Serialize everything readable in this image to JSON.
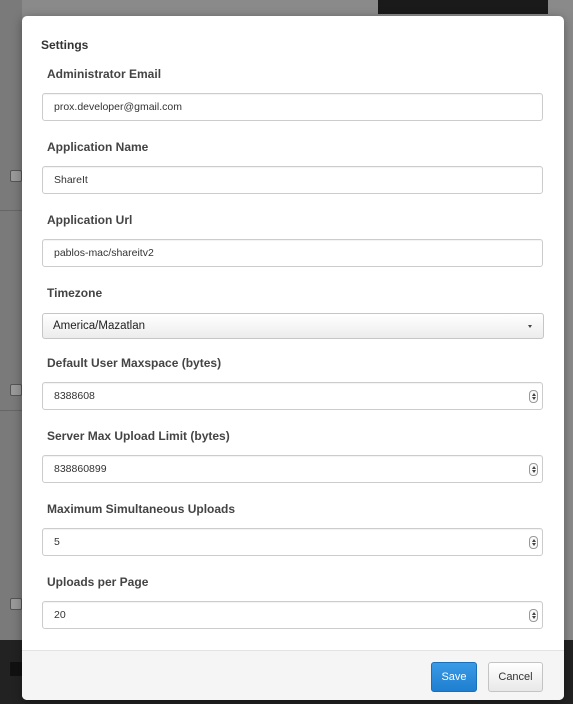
{
  "modal": {
    "title": "Settings"
  },
  "fields": {
    "admin_email": {
      "label": "Administrator Email",
      "value": "prox.developer@gmail.com"
    },
    "app_name": {
      "label": "Application Name",
      "value": "ShareIt"
    },
    "app_url": {
      "label": "Application Url",
      "value": "pablos-mac/shareitv2"
    },
    "timezone": {
      "label": "Timezone",
      "value": "America/Mazatlan"
    },
    "default_maxspace": {
      "label": "Default User Maxspace (bytes)",
      "value": "8388608"
    },
    "server_upload_limit": {
      "label": "Server Max Upload Limit (bytes)",
      "value": "838860899"
    },
    "max_simultaneous": {
      "label": "Maximum Simultaneous Uploads",
      "value": "5"
    },
    "uploads_per_page": {
      "label": "Uploads per Page",
      "value": "20"
    }
  },
  "footer": {
    "save_label": "Save",
    "cancel_label": "Cancel"
  },
  "colors": {
    "primary_button": "#2a8ddc",
    "modal_background": "#ffffff",
    "footer_background": "#f5f5f5"
  },
  "icons": {
    "select_caret": "chevron-down-icon",
    "number_spinner": "spinner-icon"
  }
}
